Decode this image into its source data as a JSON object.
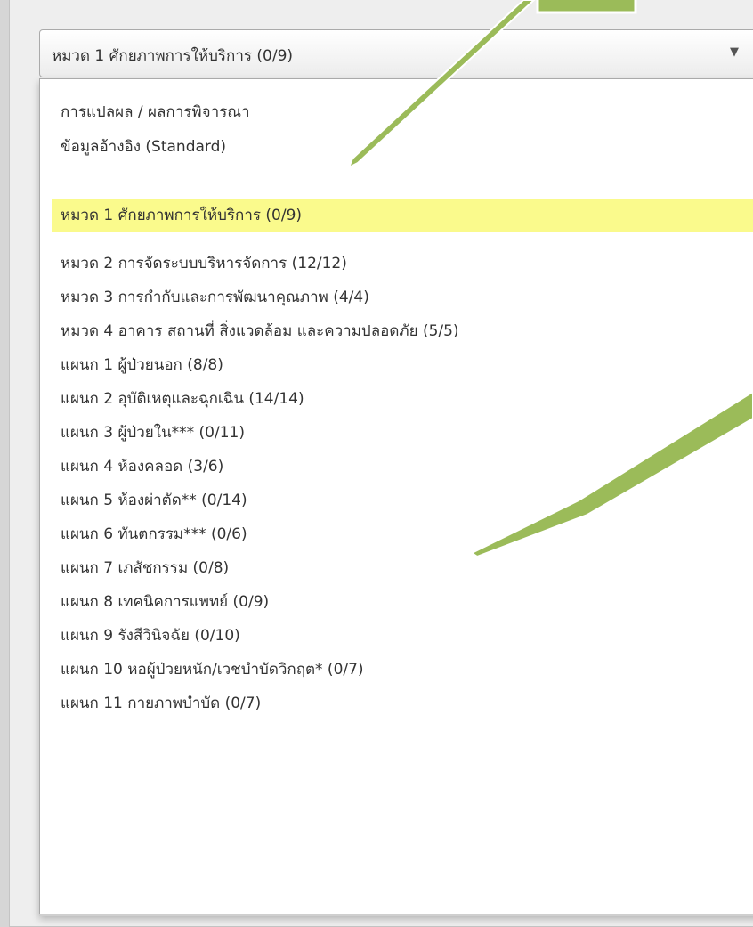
{
  "select": {
    "value": "หมวด 1 ศักยภาพการให้บริการ (0/9)",
    "arrow_icon": "triangle-down-icon"
  },
  "options": [
    "การแปลผล / ผลการพิจารณา",
    "ข้อมูลอ้างอิง (Standard)",
    "หมวด 1 ศักยภาพการให้บริการ (0/9)",
    "หมวด 2 การจัดระบบบริหารจัดการ (12/12)",
    "หมวด 3 การกำกับและการพัฒนาคุณภาพ (4/4)",
    "หมวด 4 อาคาร สถานที่ สิ่งแวดล้อม และความปลอดภัย (5/5)",
    "แผนก 1 ผู้ป่วยนอก (8/8)",
    "แผนก 2 อุบัติเหตุและฉุกเฉิน (14/14)",
    "แผนก 3 ผู้ป่วยใน*** (0/11)",
    "แผนก 4 ห้องคลอด (3/6)",
    "แผนก 5 ห้องผ่าตัด** (0/14)",
    "แผนก 6 ทันตกรรม*** (0/6)",
    "แผนก 7 เภสัชกรรม (0/8)",
    "แผนก 8 เทคนิคการแพทย์ (0/9)",
    "แผนก 9 รังสีวินิจฉัย (0/10)",
    "แผนก 10 หอผู้ป่วยหนัก/เวชบำบัดวิกฤต* (0/7)",
    "แผนก 11 กายภาพบำบัด (0/7)"
  ],
  "highlighted_index": 2,
  "colors": {
    "highlight": "#fafa8c",
    "annotation_arrow": "#9bbb59"
  }
}
